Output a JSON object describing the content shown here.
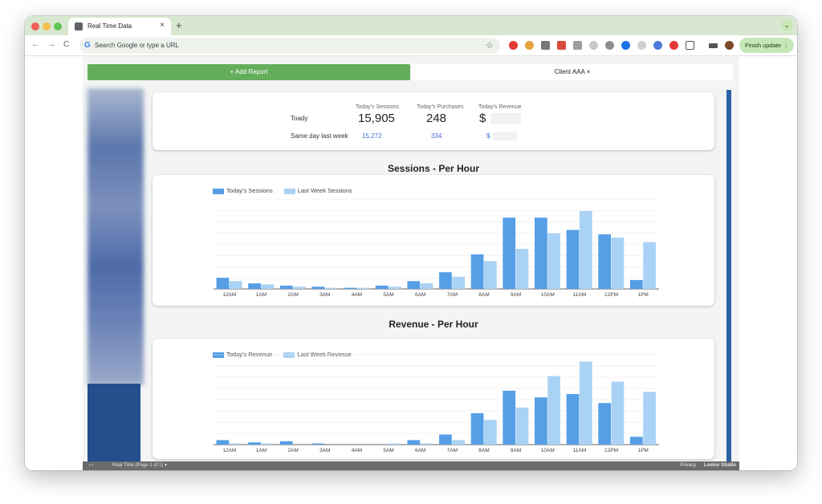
{
  "browser": {
    "tab_title": "Real Time Data",
    "tab_close": "×",
    "new_tab": "+",
    "tab_menu": "⌄",
    "back": "←",
    "forward": "→",
    "reload": "C",
    "address_placeholder": "Search Google or type a URL",
    "google_icon": "G",
    "star": "☆",
    "finish_update": "Finish update",
    "menu_dots": "⋮"
  },
  "report": {
    "add_report": "+ Add Report",
    "client_tab": "Client AAA  ×"
  },
  "summary": {
    "row_today": "Toady",
    "row_last_week": "Same day last week",
    "col_sessions": "Today's Sessions",
    "col_purchases": "Today's Purchases",
    "col_revenue": "Today's Revenue",
    "today_sessions": "15,905",
    "today_purchases": "248",
    "today_revenue_symbol": "$",
    "lw_sessions": "15,272",
    "lw_purchases": "334",
    "lw_revenue_symbol": "$"
  },
  "sessions_title": "Sessions - Per Hour",
  "revenue_title": "Revenue - Per Hour",
  "sessions_legend": [
    "Today's Sessions",
    "Last Week Sessions"
  ],
  "revenue_legend": [
    "Today's Revenue",
    "Last Week Revenue"
  ],
  "colors": {
    "today": "#569fe6",
    "last_week": "#aad2f5",
    "accent_green": "#63ad5b",
    "accent_blue": "#2c62a4"
  },
  "chart_data": [
    {
      "type": "bar",
      "title": "Sessions - Per Hour",
      "categories": [
        "12AM",
        "1AM",
        "2AM",
        "3AM",
        "4AM",
        "5AM",
        "6AM",
        "7AM",
        "8AM",
        "9AM",
        "10AM",
        "11AM",
        "12PM",
        "1PM"
      ],
      "series": [
        {
          "name": "Today's Sessions",
          "values": [
            10,
            5,
            3,
            2,
            1,
            3,
            7,
            15,
            31,
            64,
            64,
            53,
            49,
            8
          ]
        },
        {
          "name": "Last Week Sessions",
          "values": [
            7,
            4,
            2,
            1,
            1,
            2,
            5,
            11,
            25,
            36,
            50,
            70,
            46,
            42
          ]
        }
      ],
      "grid": true
    },
    {
      "type": "bar",
      "title": "Revenue - Per Hour",
      "categories": [
        "12AM",
        "1AM",
        "2AM",
        "3AM",
        "4AM",
        "5AM",
        "6AM",
        "7AM",
        "8AM",
        "9AM",
        "10AM",
        "11AM",
        "12PM",
        "1PM"
      ],
      "series": [
        {
          "name": "Today's Revenue",
          "values": [
            4,
            2,
            3,
            1,
            0,
            0,
            4,
            9,
            28,
            48,
            42,
            45,
            37,
            7
          ]
        },
        {
          "name": "Last Week Revenue",
          "values": [
            1,
            1,
            0,
            0,
            0,
            1,
            1,
            4,
            22,
            33,
            61,
            74,
            56,
            47
          ]
        }
      ],
      "grid": true
    }
  ],
  "footer": {
    "nav": "‹  ›",
    "page_label": "Real Time (Page 1 of 1)  ▾",
    "privacy": "Privacy",
    "brand": "Looker Studio"
  }
}
